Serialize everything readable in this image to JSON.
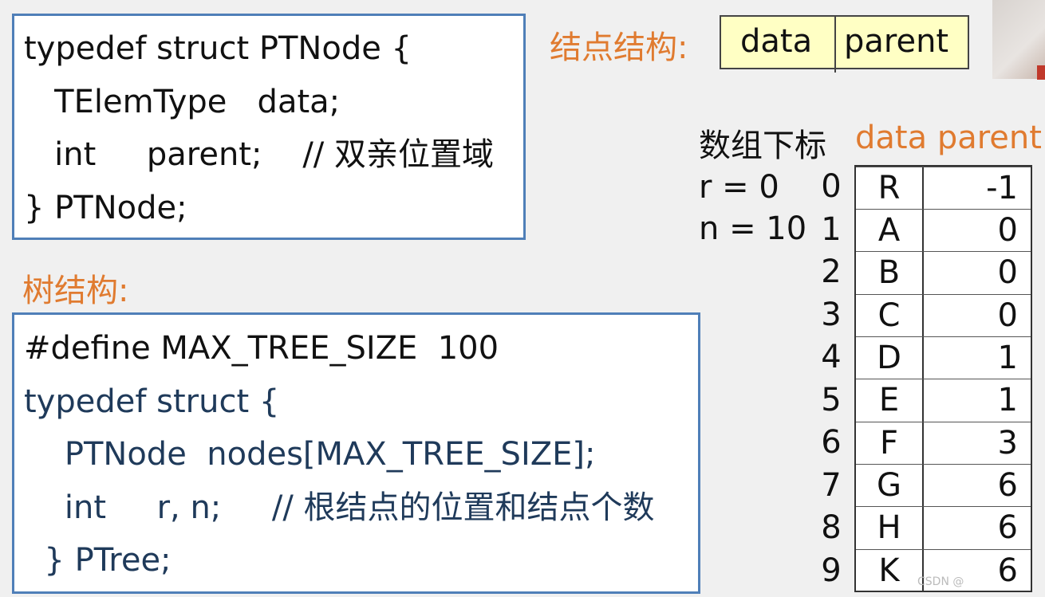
{
  "node_def": {
    "lines": [
      "typedef struct PTNode {",
      "   TElemType   data;",
      "   int     parent;    // 双亲位置域",
      "} PTNode;"
    ]
  },
  "labels": {
    "node_structure": "结点结构:",
    "tree_structure": "树结构:",
    "array_index": "数组下标",
    "data_parent": "data parent",
    "r_line": "r = 0",
    "n_line": "n = 10"
  },
  "node_structure_fields": {
    "data": "data",
    "parent": "parent"
  },
  "tree_def": {
    "lines": [
      "#define MAX_TREE_SIZE  100",
      "typedef struct {",
      "    PTNode  nodes[MAX_TREE_SIZE];",
      "    int     r, n;     // 根结点的位置和结点个数",
      "  } PTree;"
    ]
  },
  "array": {
    "indices": [
      "0",
      "1",
      "2",
      "3",
      "4",
      "5",
      "6",
      "7",
      "8",
      "9"
    ],
    "rows": [
      {
        "data": "R",
        "parent": "-1"
      },
      {
        "data": "A",
        "parent": "0"
      },
      {
        "data": "B",
        "parent": "0"
      },
      {
        "data": "C",
        "parent": "0"
      },
      {
        "data": "D",
        "parent": "1"
      },
      {
        "data": "E",
        "parent": "1"
      },
      {
        "data": "F",
        "parent": "3"
      },
      {
        "data": "G",
        "parent": "6"
      },
      {
        "data": "H",
        "parent": "6"
      },
      {
        "data": "K",
        "parent": "6"
      }
    ]
  },
  "watermark": "CSDN @",
  "colors": {
    "accent_orange": "#e07b30",
    "box_border": "#4f7fb8",
    "struct_fill": "#ffffc4",
    "code_navy": "#1f3a5a"
  }
}
